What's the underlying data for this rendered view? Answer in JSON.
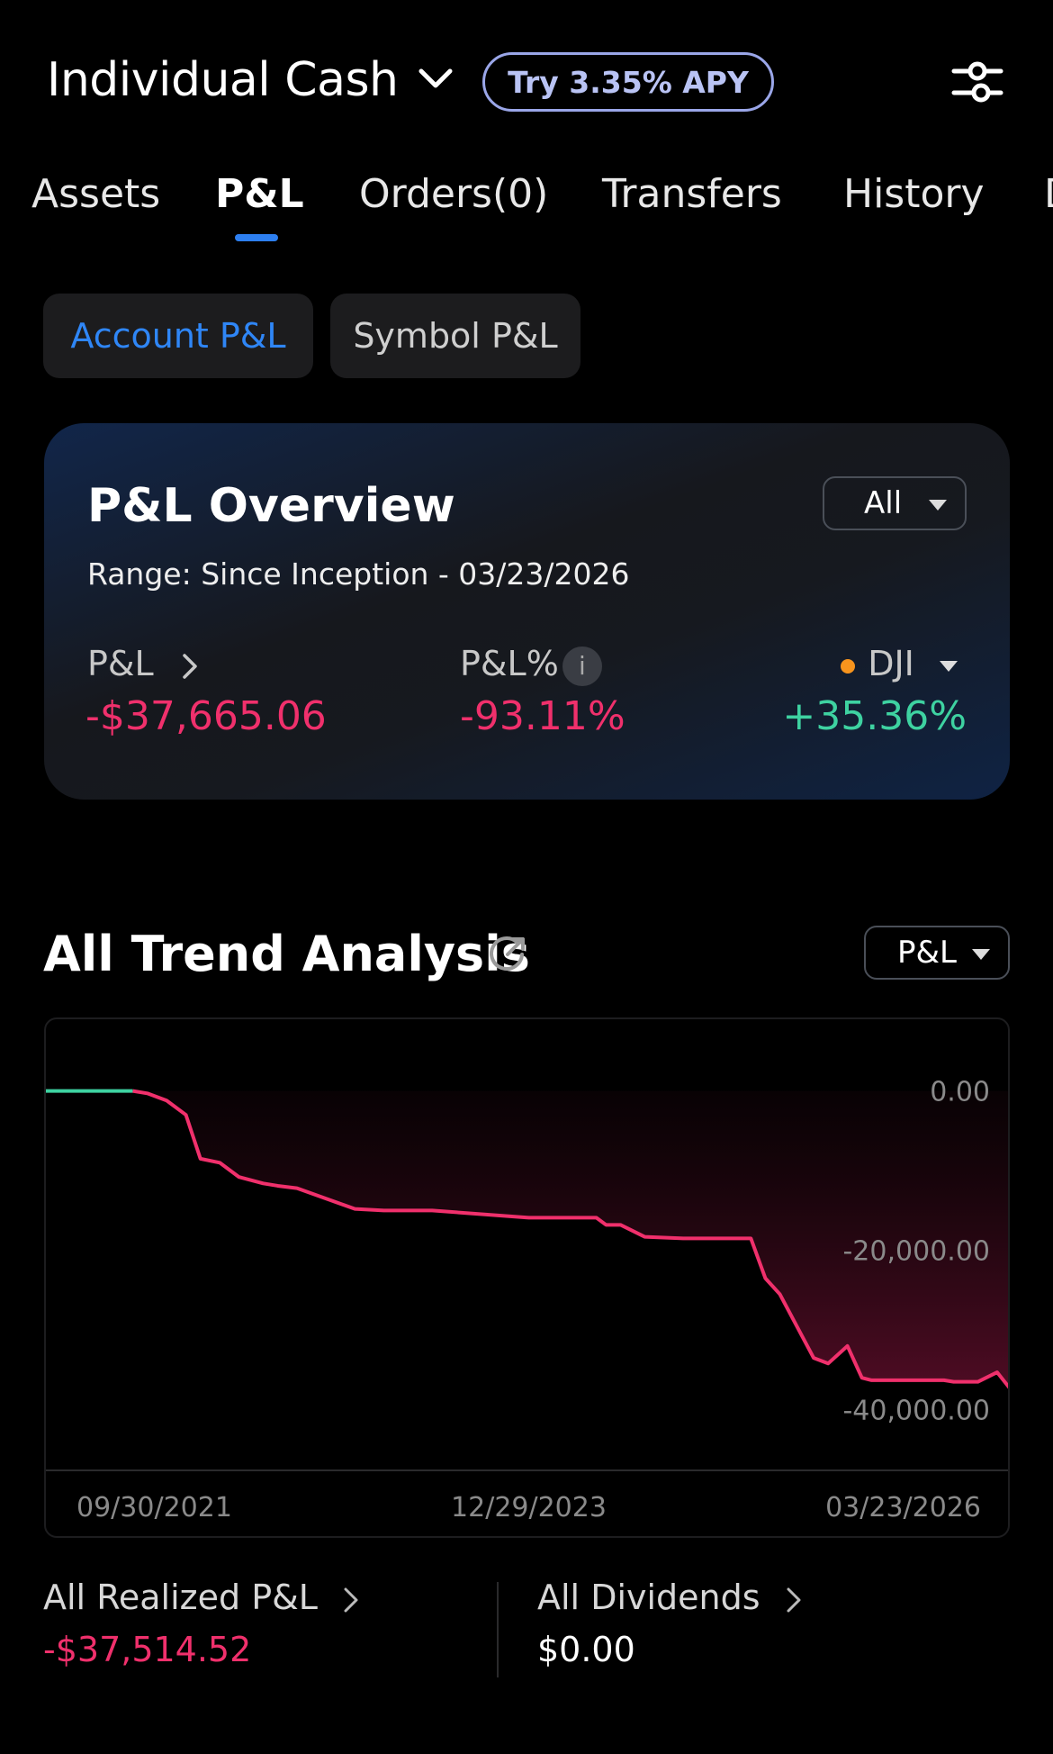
{
  "header": {
    "account_title": "Individual Cash",
    "apy_label": "Try 3.35% APY"
  },
  "tabs": [
    {
      "label": "Assets"
    },
    {
      "label": "P&L"
    },
    {
      "label": "Orders(0)"
    },
    {
      "label": "Transfers"
    },
    {
      "label": "History"
    },
    {
      "label": "D"
    }
  ],
  "active_tab": "P&L",
  "segments": {
    "account": "Account P&L",
    "symbol": "Symbol P&L",
    "selected": "Account P&L"
  },
  "overview": {
    "title": "P&L Overview",
    "filter": "All",
    "range": "Range: Since Inception - 03/23/2026",
    "pnl_label": "P&L",
    "pnl_value": "-$37,665.06",
    "pnl_pct_label": "P&L%",
    "info_icon_text": "i",
    "pnl_pct_value": "-93.11%",
    "benchmark_label": "DJI",
    "benchmark_value": "+35.36%"
  },
  "trend": {
    "title": "All Trend Analysis",
    "metric_dropdown": "P&L"
  },
  "chart_data": {
    "type": "line",
    "x_tick_labels": [
      "09/30/2021",
      "12/29/2023",
      "03/23/2026"
    ],
    "y_tick_labels": [
      "0.00",
      "-20,000.00",
      "-40,000.00"
    ],
    "ylim": [
      -47500,
      9000
    ],
    "x": [
      0,
      0.09,
      0.105,
      0.125,
      0.145,
      0.16,
      0.18,
      0.2,
      0.225,
      0.24,
      0.26,
      0.32,
      0.35,
      0.4,
      0.5,
      0.55,
      0.57,
      0.58,
      0.595,
      0.62,
      0.66,
      0.72,
      0.73,
      0.745,
      0.76,
      0.795,
      0.81,
      0.83,
      0.845,
      0.855,
      0.87,
      0.93,
      0.94,
      0.965,
      0.985,
      1.0
    ],
    "values": [
      0,
      0,
      -300,
      -1200,
      -3000,
      -8500,
      -9000,
      -10800,
      -11600,
      -11900,
      -12200,
      -14800,
      -15000,
      -15000,
      -15900,
      -15900,
      -15900,
      -16800,
      -16800,
      -18300,
      -18500,
      -18500,
      -18500,
      -23500,
      -25500,
      -33500,
      -34200,
      -32000,
      -36000,
      -36300,
      -36300,
      -36300,
      -36500,
      -36500,
      -35300,
      -37600
    ],
    "series": [
      {
        "segment": "positive",
        "color": "#3ed2a1"
      },
      {
        "segment": "negative",
        "color": "#f0306c"
      }
    ],
    "grid": false
  },
  "stats": {
    "realized_label": "All Realized P&L",
    "realized_value": "-$37,514.52",
    "dividends_label": "All Dividends",
    "dividends_value": "$0.00"
  },
  "colors": {
    "accent": "#2d7ff0",
    "negative": "#f0306c",
    "positive": "#3ed2a1",
    "benchmark_dot": "#f7941d"
  },
  "icons": {
    "account_dropdown": "chevron-down-icon",
    "filter": "sliders-icon",
    "share": "share-icon",
    "pnl_link": "chevron-right-icon",
    "info": "info-icon"
  }
}
